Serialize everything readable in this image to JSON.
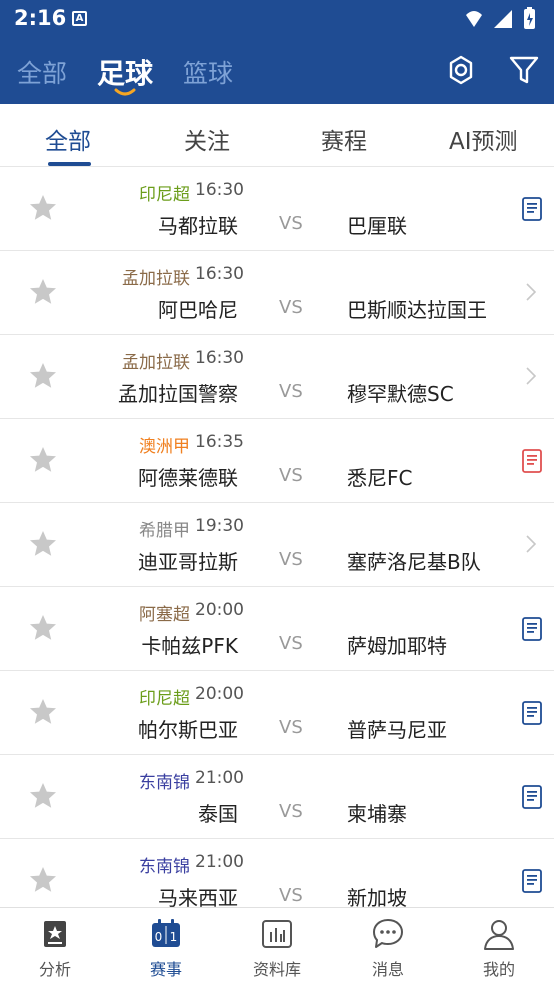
{
  "status": {
    "time": "2:16",
    "a_badge": "A"
  },
  "header": {
    "nav": [
      {
        "label": "全部"
      },
      {
        "label": "足球"
      },
      {
        "label": "篮球"
      }
    ]
  },
  "subtabs": [
    {
      "label": "全部"
    },
    {
      "label": "关注"
    },
    {
      "label": "赛程"
    },
    {
      "label": "AI预测"
    }
  ],
  "colors": {
    "brand": "#1f4c93",
    "league_green": "#6b9d1a",
    "league_brown": "#8a6a48",
    "league_orange": "#f08020",
    "league_blue": "#3a3fa0",
    "league_gray": "#888888"
  },
  "matches": [
    {
      "league": "印尼超",
      "league_color": "#6b9d1a",
      "time": "16:30",
      "home": "马都拉联",
      "vs": "VS",
      "away": "巴厘联",
      "indicator": "doc-blue"
    },
    {
      "league": "孟加拉联",
      "league_color": "#8a6a48",
      "time": "16:30",
      "home": "阿巴哈尼",
      "vs": "VS",
      "away": "巴斯顺达拉国王",
      "indicator": "chevron"
    },
    {
      "league": "孟加拉联",
      "league_color": "#8a6a48",
      "time": "16:30",
      "home": "孟加拉国警察",
      "vs": "VS",
      "away": "穆罕默德SC",
      "indicator": "chevron"
    },
    {
      "league": "澳洲甲",
      "league_color": "#f08020",
      "time": "16:35",
      "home": "阿德莱德联",
      "vs": "VS",
      "away": "悉尼FC",
      "indicator": "doc-red"
    },
    {
      "league": "希腊甲",
      "league_color": "#888888",
      "time": "19:30",
      "home": "迪亚哥拉斯",
      "vs": "VS",
      "away": "塞萨洛尼基B队",
      "indicator": "chevron"
    },
    {
      "league": "阿塞超",
      "league_color": "#8a6a48",
      "time": "20:00",
      "home": "卡帕兹PFK",
      "vs": "VS",
      "away": "萨姆加耶特",
      "indicator": "doc-blue"
    },
    {
      "league": "印尼超",
      "league_color": "#6b9d1a",
      "time": "20:00",
      "home": "帕尔斯巴亚",
      "vs": "VS",
      "away": "普萨马尼亚",
      "indicator": "doc-blue"
    },
    {
      "league": "东南锦",
      "league_color": "#3a3fa0",
      "time": "21:00",
      "home": "泰国",
      "vs": "VS",
      "away": "柬埔寨",
      "indicator": "doc-blue"
    },
    {
      "league": "东南锦",
      "league_color": "#3a3fa0",
      "time": "21:00",
      "home": "马来西亚",
      "vs": "VS",
      "away": "新加坡",
      "indicator": "doc-blue"
    }
  ],
  "bottomnav": [
    {
      "label": "分析",
      "icon": "analysis-icon"
    },
    {
      "label": "赛事",
      "icon": "scoreboard-icon"
    },
    {
      "label": "资料库",
      "icon": "database-chart-icon"
    },
    {
      "label": "消息",
      "icon": "message-icon"
    },
    {
      "label": "我的",
      "icon": "user-icon"
    }
  ]
}
